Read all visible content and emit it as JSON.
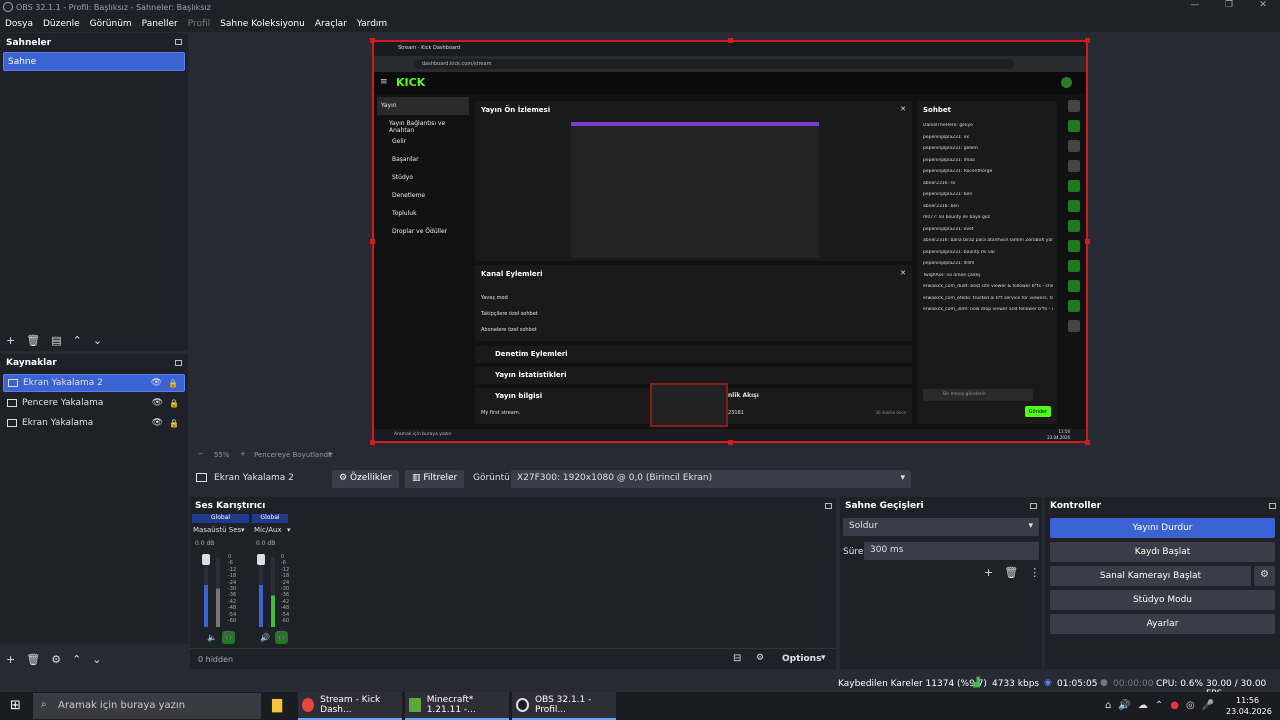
{
  "window": {
    "title": "OBS 32.1.1 - Profil: Başlıksız - Sahneler: Başlıksız",
    "controls": [
      "—",
      "❐",
      "✕"
    ]
  },
  "menu": [
    "Dosya",
    "Düzenle",
    "Görünüm",
    "Paneller",
    "Profil",
    "Sahne Koleksiyonu",
    "Araçlar",
    "Yardım"
  ],
  "scenes": {
    "title": "Sahneler",
    "items": [
      "Sahne"
    ]
  },
  "sources": {
    "title": "Kaynaklar",
    "items": [
      "Ekran Yakalama 2",
      "Pencere Yakalama",
      "Ekran Yakalama"
    ]
  },
  "preview_bar": {
    "zoom": "55%",
    "mode": "Pencereye Boyutlandır"
  },
  "source_bar": {
    "selected": "Ekran Yakalama 2",
    "properties": "Özellikler",
    "filters": "Filtreler",
    "display_label": "Görüntü",
    "display_value": "X27F300: 1920x1080 @ 0,0 (Birincil Ekran)"
  },
  "mixer": {
    "title": "Ses Karıştırıcı",
    "channels": [
      {
        "tag": "Global",
        "name": "Masaüstü Ses",
        "db": "0.0 dB"
      },
      {
        "tag": "Global",
        "name": "Mic/Aux",
        "db": "0.0 dB"
      }
    ],
    "scale": [
      "0",
      "-6",
      "-12",
      "-18",
      "-24",
      "-30",
      "-36",
      "-42",
      "-48",
      "-54",
      "-60"
    ],
    "hidden": "0 hidden",
    "options": "Options"
  },
  "transitions": {
    "title": "Sahne Geçişleri",
    "type": "Soldur",
    "duration_label": "Süre",
    "duration": "300 ms"
  },
  "controls": {
    "title": "Kontroller",
    "buttons": [
      "Yayını Durdur",
      "Kaydı Başlat",
      "Sanal Kamerayı Başlat",
      "Stüdyo Modu",
      "Ayarlar"
    ]
  },
  "status": {
    "dropped": "Kaybedilen Kareler 11374 (%9.7)",
    "bitrate": "4733 kbps",
    "stream_time": "01:05:05",
    "rec_time": "00:00:00",
    "cpu": "CPU: 0.6%",
    "fps": "30.00 / 30.00 FPS"
  },
  "taskbar": {
    "search": "Aramak için buraya yazın",
    "apps": [
      "Stream - Kick Dash...",
      "Minecraft* 1.21.11 -...",
      "OBS 32.1.1 - Profil..."
    ],
    "time": "11:56",
    "date": "23.04.2026"
  },
  "kick": {
    "tab": "Stream - Kick Dashboard",
    "url": "dashboard.kick.com/stream",
    "logo": "KICK",
    "nav": [
      "Yayın",
      "Yayın Bağlantısı ve Anahtarı",
      "Gelir",
      "Başarılar",
      "Stüdyo",
      "Denetleme",
      "Topluluk",
      "Droplar ve Ödüller"
    ],
    "preview_title": "Yayın Ön İzlemesi",
    "channel_actions": "Kanal Eylemleri",
    "actions": [
      "Yavaş mod",
      "Takipçilere özel sohbet",
      "Abonelere özel sohbet"
    ],
    "moderation": "Denetim Eylemleri",
    "stats": "Yayın İstatistikleri",
    "info": "Yayın bilgisi",
    "info_title": "My first stream.",
    "activity": "nlik Akışı",
    "activity_value": "23181",
    "activity_time": "36 dakika önce",
    "chat_title": "Sohbet",
    "chat": [
      "DanielTheHero: geliyo",
      "pepeninplpla231: xx",
      "pepeninplpla231: gelem",
      "pepeninplpla231: lmao",
      "pepeninplpla231: Rocenthorge",
      "abner2316: ss",
      "pepeninplpla231: ben",
      "abner2316: ben",
      "m077: lol bounty ile baya gez",
      "pepeninplpla231: evet",
      "abner2316: bana biraz para atarmısın lamlm ZeroboX yani başladım",
      "pepeninplpla231: bounty mi var",
      "pepeninplpla231: lllllm",
      "TwighAss: no amoe çaldış",
      "erwaikck_com_dudt: best site viewer & follower b*ts - cheapest prices guaranteed (take a look at *b.n a kick .com*) (Deleted)",
      "erwaikck_com_efedo: trusted ai b*t service for viewers, followers & chatters (take a look at *b.n a kick .com*) (Deleted)",
      "erwaikck_com_30m: now drop viewer and follower b*ts - cheapest on the market (take a look at *b.n a kick.com*) (Deleted)"
    ],
    "chat_placeholder": "Bir mesaj gönderin",
    "send": "Gönder",
    "win_search": "Aramak için buraya yazın",
    "win_time": "11:56",
    "win_date": "23.04.2026"
  }
}
